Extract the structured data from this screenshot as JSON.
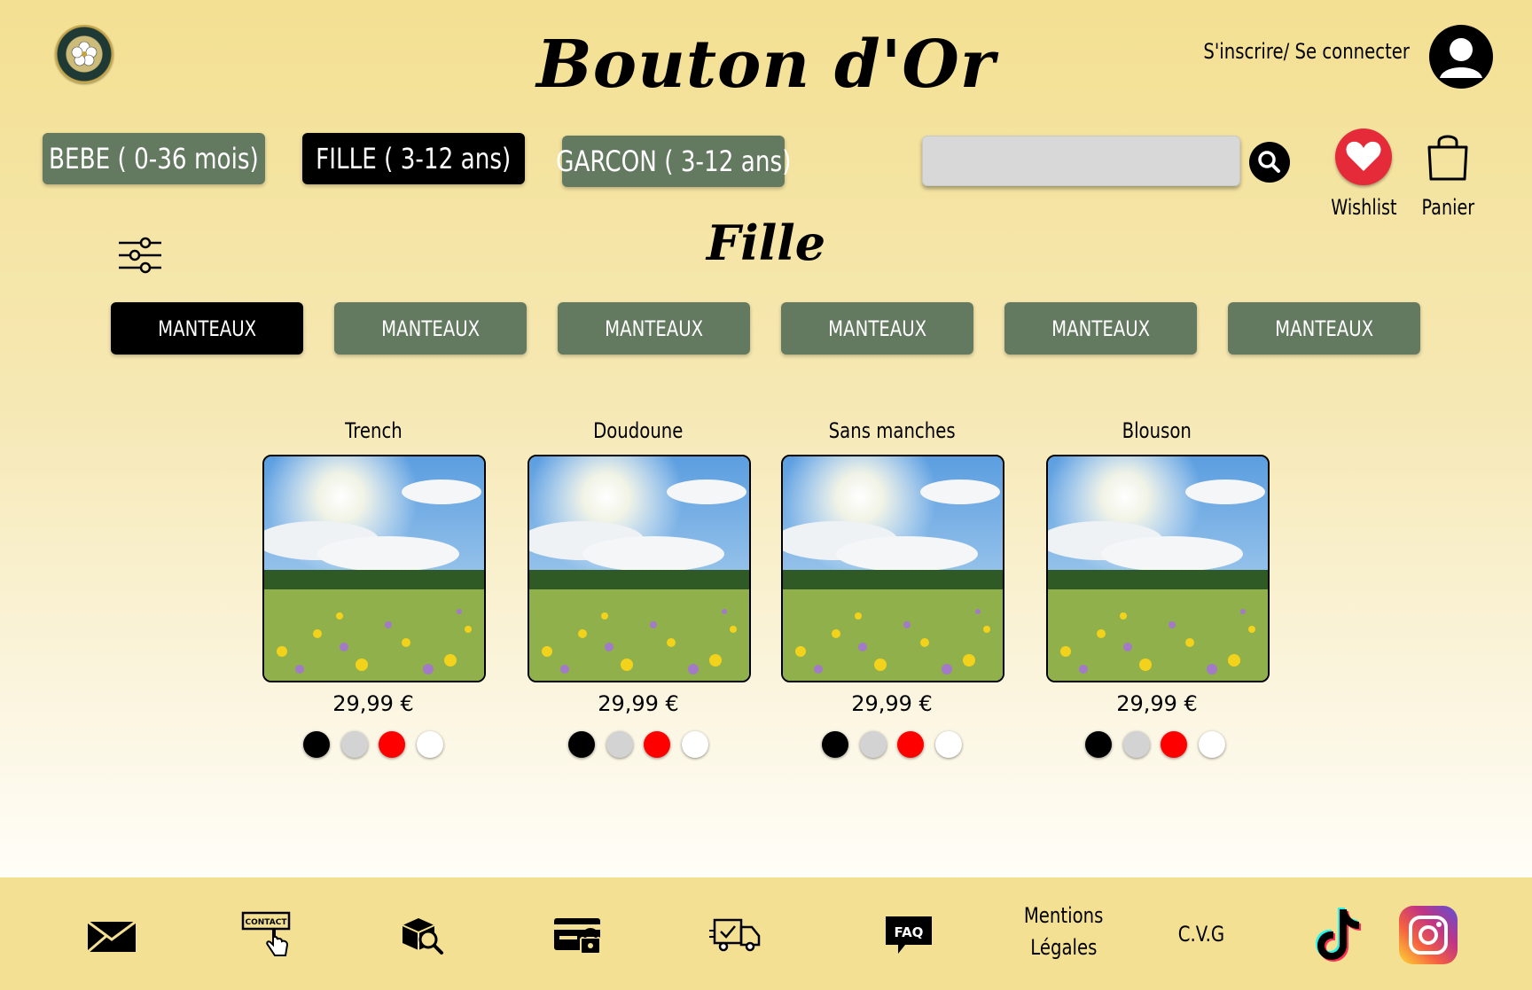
{
  "header": {
    "brand": "Bouton d'Or",
    "auth_label": "S'inscrire/ Se connecter"
  },
  "categories": [
    {
      "label": "BEBE ( 0-36 mois)",
      "active": false
    },
    {
      "label": "FILLE ( 3-12 ans)",
      "active": true
    },
    {
      "label": "GARCON ( 3-12 ans)",
      "active": false
    }
  ],
  "search": {
    "placeholder": ""
  },
  "wishlist_label": "Wishlist",
  "cart_label": "Panier",
  "page_title": "Fille",
  "subcategories": [
    {
      "label": "MANTEAUX",
      "active": true
    },
    {
      "label": "MANTEAUX",
      "active": false
    },
    {
      "label": "MANTEAUX",
      "active": false
    },
    {
      "label": "MANTEAUX",
      "active": false
    },
    {
      "label": "MANTEAUX",
      "active": false
    },
    {
      "label": "MANTEAUX",
      "active": false
    }
  ],
  "products": [
    {
      "name": "Trench",
      "price": "29,99 €"
    },
    {
      "name": "Doudoune",
      "price": "29,99 €"
    },
    {
      "name": "Sans manches",
      "price": "29,99 €"
    },
    {
      "name": "Blouson",
      "price": "29,99 €"
    }
  ],
  "swatch_colors": [
    "#000000",
    "#d3d3d3",
    "#ff0000",
    "#ffffff"
  ],
  "footer": {
    "mentions_line1": "Mentions",
    "mentions_line2": "Légales",
    "cvg": "C.V.G",
    "icons": [
      "mail-icon",
      "contact-icon",
      "package-search-icon",
      "secure-payment-icon",
      "delivery-truck-icon",
      "faq-icon",
      "tiktok-icon",
      "instagram-icon"
    ]
  },
  "colors": {
    "accent_green": "#637a60",
    "background": "#f3e092",
    "heart": "#e52b3a"
  }
}
